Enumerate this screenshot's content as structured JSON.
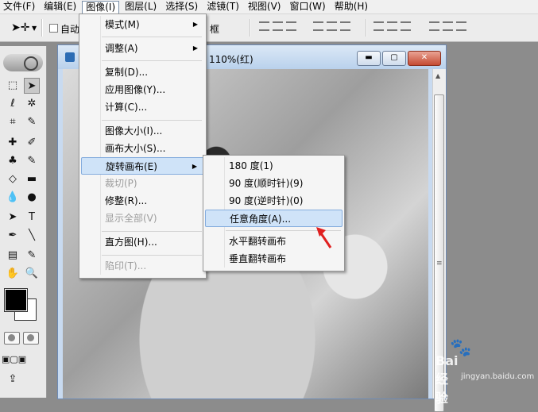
{
  "menubar": {
    "items": [
      "文件(F)",
      "编辑(E)",
      "图像(I)",
      "图层(L)",
      "选择(S)",
      "滤镜(T)",
      "视图(V)",
      "窗口(W)",
      "帮助(H)"
    ],
    "active_index": 2
  },
  "options_bar": {
    "auto_select_label": "自动",
    "tail_label": "框"
  },
  "document": {
    "title": "110%(红)",
    "minimize": "▬",
    "restore": "▢",
    "close": "✕"
  },
  "image_menu": {
    "items": [
      {
        "label": "模式(M)",
        "submenu": true,
        "disabled": false
      },
      {
        "label": "调整(A)",
        "submenu": true,
        "disabled": false
      },
      {
        "label": "复制(D)...",
        "submenu": false,
        "disabled": false
      },
      {
        "label": "应用图像(Y)...",
        "submenu": false,
        "disabled": false
      },
      {
        "label": "计算(C)...",
        "submenu": false,
        "disabled": false
      },
      {
        "label": "图像大小(I)...",
        "submenu": false,
        "disabled": false
      },
      {
        "label": "画布大小(S)...",
        "submenu": false,
        "disabled": false
      },
      {
        "label": "旋转画布(E)",
        "submenu": true,
        "disabled": false
      },
      {
        "label": "裁切(P)",
        "submenu": false,
        "disabled": true
      },
      {
        "label": "修整(R)...",
        "submenu": false,
        "disabled": false
      },
      {
        "label": "显示全部(V)",
        "submenu": false,
        "disabled": true
      },
      {
        "label": "直方图(H)...",
        "submenu": false,
        "disabled": false
      },
      {
        "label": "陷印(T)...",
        "submenu": false,
        "disabled": true
      }
    ],
    "highlighted_index": 7
  },
  "rotate_submenu": {
    "items": [
      "180 度(1)",
      "90 度(顺时针)(9)",
      "90 度(逆时针)(0)",
      "任意角度(A)...",
      "水平翻转画布",
      "垂直翻转画布"
    ],
    "highlighted_index": 3
  },
  "watermark": {
    "text": "Bai 经验",
    "url": "jingyan.baidu.com"
  },
  "colors": {
    "highlight": "#cfe3f8",
    "arrow": "#e02020"
  }
}
